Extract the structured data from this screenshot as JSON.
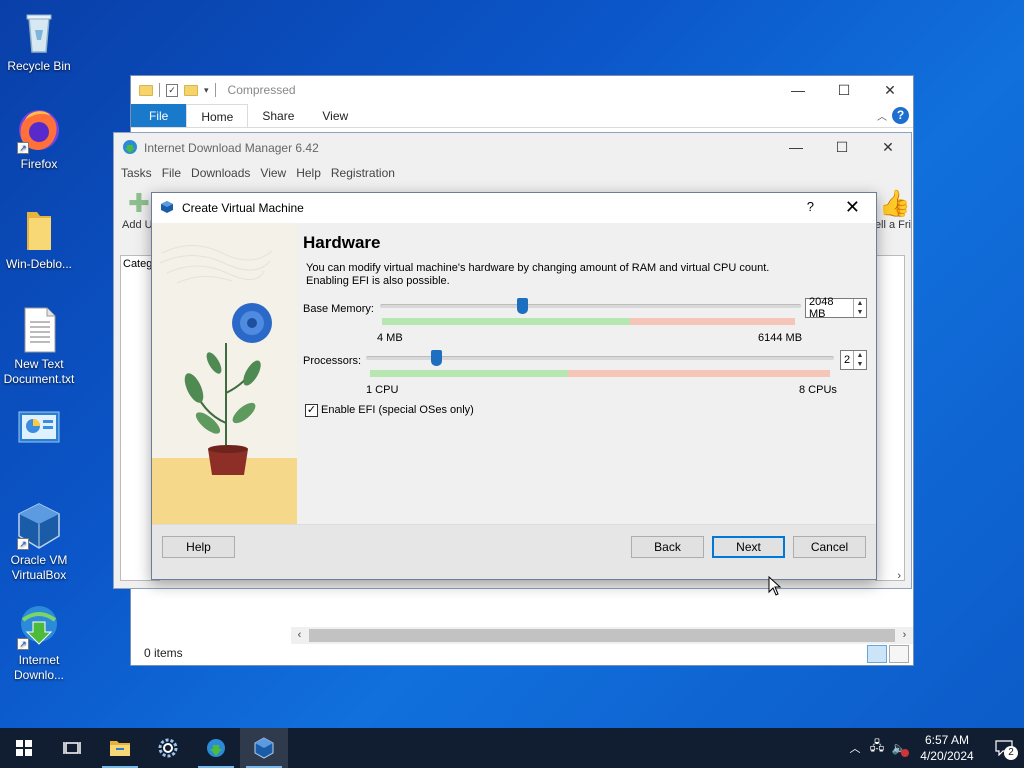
{
  "desktop": {
    "icons": [
      {
        "label": "Recycle Bin"
      },
      {
        "label": "Firefox"
      },
      {
        "label": "Win-Deblo..."
      },
      {
        "label": "New Text Document.txt"
      },
      {
        "label": ""
      },
      {
        "label": "Oracle VM VirtualBox"
      },
      {
        "label": "Internet Downlo..."
      }
    ]
  },
  "explorer": {
    "title": "Compressed",
    "tabs": [
      "File",
      "Home",
      "Share",
      "View"
    ],
    "status": "0 items"
  },
  "idm": {
    "title": "Internet Download Manager 6.42",
    "menu": [
      "Tasks",
      "File",
      "Downloads",
      "View",
      "Help",
      "Registration"
    ],
    "toolbar_left": "Add U",
    "toolbar_right": "ell a Fri",
    "categories_label": "Categ"
  },
  "dialog": {
    "title": "Create Virtual Machine",
    "help_glyph": "?",
    "heading": "Hardware",
    "description_line1": "You can modify virtual machine's hardware by changing amount of RAM and virtual CPU count.",
    "description_line2": "Enabling EFI is also possible.",
    "memory": {
      "label": "Base Memory:",
      "value": "2048 MB",
      "min_label": "4 MB",
      "max_label": "6144 MB",
      "fraction": 0.333
    },
    "processors": {
      "label": "Processors:",
      "value": "2",
      "min_label": "1 CPU",
      "max_label": "8 CPUs",
      "fraction": 0.143
    },
    "efi": {
      "label": "Enable EFI (special OSes only)",
      "checked": true
    },
    "buttons": {
      "help": "Help",
      "back": "Back",
      "next": "Next",
      "cancel": "Cancel"
    }
  },
  "taskbar": {
    "time": "6:57 AM",
    "date": "4/20/2024",
    "notification_count": "2"
  }
}
